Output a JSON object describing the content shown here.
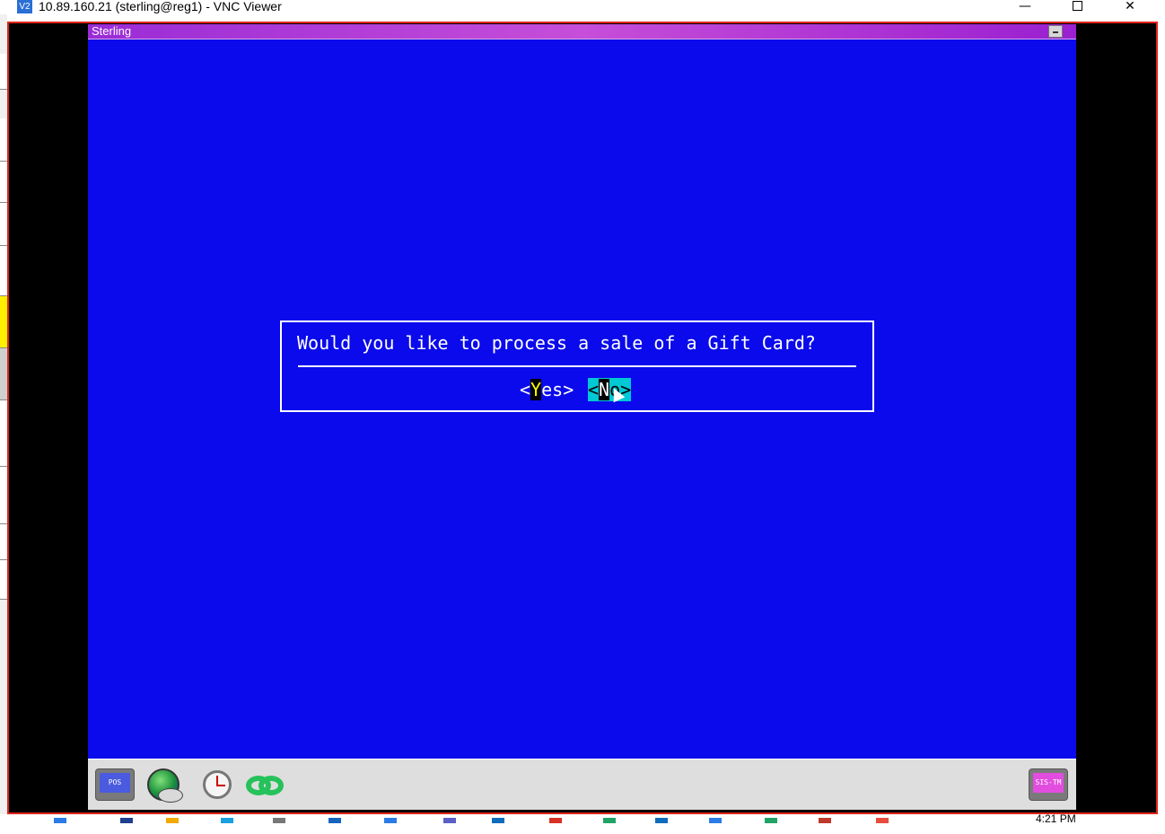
{
  "vnc_window": {
    "title": "10.89.160.21 (sterling@reg1) - VNC Viewer",
    "app_icon_text": "V2",
    "controls": {
      "minimize": "—",
      "maximize": "",
      "close": "✕"
    }
  },
  "sterling": {
    "title": "Sterling",
    "dialog": {
      "question": "Would you like to process a sale of a Gift Card?",
      "yes": {
        "open": "<",
        "hotkey": "Y",
        "rest": "es",
        "close": ">"
      },
      "no": {
        "open": "<",
        "hotkey": "N",
        "rest": "o",
        "close": ">"
      }
    },
    "taskbar": {
      "pos_label": "POS",
      "sis_label": "SIS-TM"
    }
  },
  "host_taskbar": {
    "clock": "4:21 PM"
  },
  "colors": {
    "terminal_bg": "#0a0aec",
    "titlebar": "#b23fd8",
    "selected_button": "#00c8d4",
    "hotkey": "#ffff00",
    "border": "#e0241b"
  }
}
